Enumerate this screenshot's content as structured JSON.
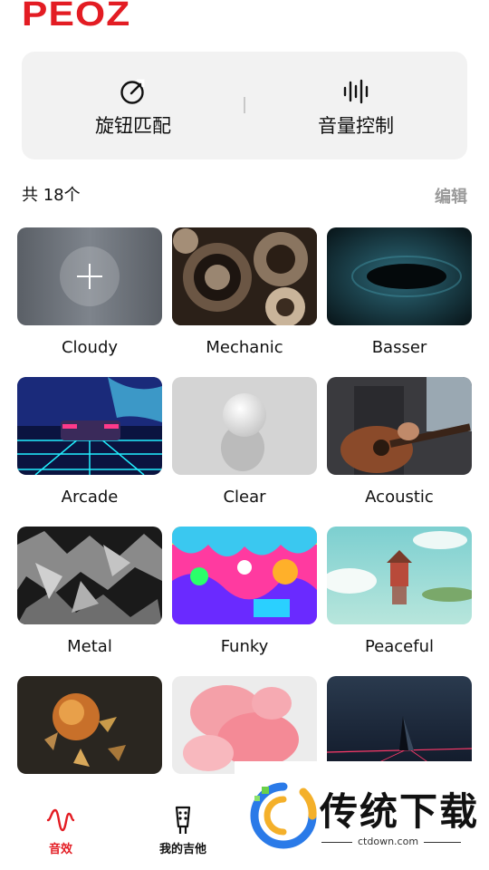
{
  "app": {
    "logo": "PEOZ"
  },
  "tools": {
    "knob_match": {
      "label": "旋钮匹配",
      "icon": "knob-icon"
    },
    "volume_control": {
      "label": "音量控制",
      "icon": "sound-wave-icon"
    }
  },
  "list": {
    "count_label": "共 18个",
    "edit_label": "编辑"
  },
  "presets": [
    {
      "name": "Cloudy",
      "thumb": "add-placeholder"
    },
    {
      "name": "Mechanic",
      "thumb": "gears"
    },
    {
      "name": "Basser",
      "thumb": "dark-ripple"
    },
    {
      "name": "Arcade",
      "thumb": "neon-car"
    },
    {
      "name": "Clear",
      "thumb": "white-sphere"
    },
    {
      "name": "Acoustic",
      "thumb": "acoustic-guitar"
    },
    {
      "name": "Metal",
      "thumb": "crumpled-foil"
    },
    {
      "name": "Funky",
      "thumb": "colorful-graffiti"
    },
    {
      "name": "Peaceful",
      "thumb": "floating-house"
    },
    {
      "name": "",
      "thumb": "golden-shatter"
    },
    {
      "name": "",
      "thumb": "pink-smoke"
    },
    {
      "name": "",
      "thumb": "dark-pyramid"
    }
  ],
  "tabbar": {
    "effects": {
      "label": "音效",
      "icon": "wave-icon"
    },
    "my_guitar": {
      "label": "我的吉他",
      "icon": "guitar-head-icon"
    }
  },
  "watermark": {
    "title": "传统下载",
    "url": "ctdown.com"
  },
  "colors": {
    "brand_red": "#e31c23",
    "panel_bg": "#f2f2f2",
    "muted": "#9a9a9a"
  }
}
